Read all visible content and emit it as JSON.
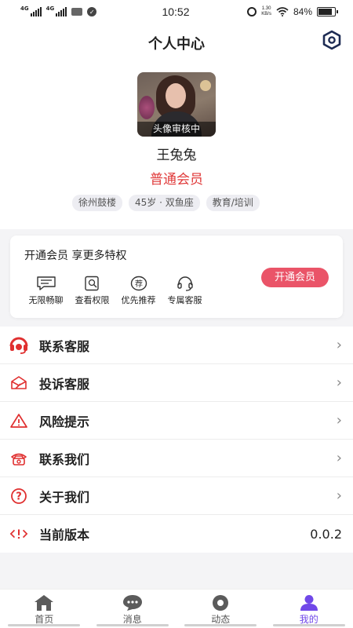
{
  "status_bar": {
    "network1": "4G",
    "network2": "4G",
    "time": "10:52",
    "speed": "1.30",
    "speed_unit": "KB/s",
    "battery_text": "84%",
    "battery_level": 0.84
  },
  "header": {
    "title": "个人中心",
    "settings_icon": "hexagon-settings-icon"
  },
  "profile": {
    "avatar_badge": "头像审核中",
    "name": "王兔兔",
    "level": "普通会员",
    "level_color": "#e03b3b",
    "tags": [
      "徐州鼓楼",
      "45岁 · 双鱼座",
      "教育/培训"
    ]
  },
  "vip": {
    "title": "开通会员 享更多特权",
    "perks": [
      {
        "label": "无限畅聊",
        "icon": "chat-icon"
      },
      {
        "label": "查看权限",
        "icon": "view-permission-icon"
      },
      {
        "label": "优先推荐",
        "icon": "recommend-icon"
      },
      {
        "label": "专属客服",
        "icon": "headset-icon"
      }
    ],
    "button": "开通会员",
    "button_color": "#ea5468"
  },
  "menu": {
    "items": [
      {
        "label": "联系客服",
        "icon": "customer-service-icon",
        "chevron": "›"
      },
      {
        "label": "投诉客服",
        "icon": "complaint-icon",
        "chevron": "›"
      },
      {
        "label": "风险提示",
        "icon": "warning-icon",
        "chevron": "›"
      },
      {
        "label": "联系我们",
        "icon": "phone-icon",
        "chevron": "›"
      },
      {
        "label": "关于我们",
        "icon": "question-icon",
        "chevron": "›"
      },
      {
        "label": "当前版本",
        "icon": "version-icon",
        "value": "0.0.2"
      }
    ]
  },
  "tabbar": {
    "tabs": [
      {
        "label": "首页",
        "icon": "home-icon"
      },
      {
        "label": "消息",
        "icon": "message-icon"
      },
      {
        "label": "动态",
        "icon": "moments-icon"
      },
      {
        "label": "我的",
        "icon": "profile-icon"
      }
    ],
    "active": "我的",
    "active_color": "#7048e8"
  }
}
